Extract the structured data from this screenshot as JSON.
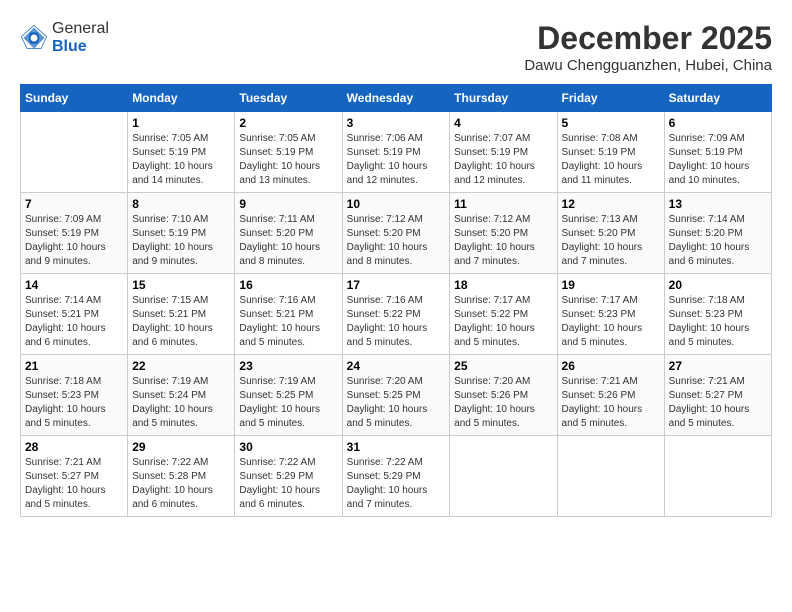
{
  "header": {
    "logo_line1": "General",
    "logo_line2": "Blue",
    "month_title": "December 2025",
    "location": "Dawu Chengguanzhen, Hubei, China"
  },
  "calendar": {
    "weekdays": [
      "Sunday",
      "Monday",
      "Tuesday",
      "Wednesday",
      "Thursday",
      "Friday",
      "Saturday"
    ],
    "weeks": [
      [
        {
          "day": "",
          "sunrise": "",
          "sunset": "",
          "daylight": ""
        },
        {
          "day": "1",
          "sunrise": "Sunrise: 7:05 AM",
          "sunset": "Sunset: 5:19 PM",
          "daylight": "Daylight: 10 hours and 14 minutes."
        },
        {
          "day": "2",
          "sunrise": "Sunrise: 7:05 AM",
          "sunset": "Sunset: 5:19 PM",
          "daylight": "Daylight: 10 hours and 13 minutes."
        },
        {
          "day": "3",
          "sunrise": "Sunrise: 7:06 AM",
          "sunset": "Sunset: 5:19 PM",
          "daylight": "Daylight: 10 hours and 12 minutes."
        },
        {
          "day": "4",
          "sunrise": "Sunrise: 7:07 AM",
          "sunset": "Sunset: 5:19 PM",
          "daylight": "Daylight: 10 hours and 12 minutes."
        },
        {
          "day": "5",
          "sunrise": "Sunrise: 7:08 AM",
          "sunset": "Sunset: 5:19 PM",
          "daylight": "Daylight: 10 hours and 11 minutes."
        },
        {
          "day": "6",
          "sunrise": "Sunrise: 7:09 AM",
          "sunset": "Sunset: 5:19 PM",
          "daylight": "Daylight: 10 hours and 10 minutes."
        }
      ],
      [
        {
          "day": "7",
          "sunrise": "Sunrise: 7:09 AM",
          "sunset": "Sunset: 5:19 PM",
          "daylight": "Daylight: 10 hours and 9 minutes."
        },
        {
          "day": "8",
          "sunrise": "Sunrise: 7:10 AM",
          "sunset": "Sunset: 5:19 PM",
          "daylight": "Daylight: 10 hours and 9 minutes."
        },
        {
          "day": "9",
          "sunrise": "Sunrise: 7:11 AM",
          "sunset": "Sunset: 5:20 PM",
          "daylight": "Daylight: 10 hours and 8 minutes."
        },
        {
          "day": "10",
          "sunrise": "Sunrise: 7:12 AM",
          "sunset": "Sunset: 5:20 PM",
          "daylight": "Daylight: 10 hours and 8 minutes."
        },
        {
          "day": "11",
          "sunrise": "Sunrise: 7:12 AM",
          "sunset": "Sunset: 5:20 PM",
          "daylight": "Daylight: 10 hours and 7 minutes."
        },
        {
          "day": "12",
          "sunrise": "Sunrise: 7:13 AM",
          "sunset": "Sunset: 5:20 PM",
          "daylight": "Daylight: 10 hours and 7 minutes."
        },
        {
          "day": "13",
          "sunrise": "Sunrise: 7:14 AM",
          "sunset": "Sunset: 5:20 PM",
          "daylight": "Daylight: 10 hours and 6 minutes."
        }
      ],
      [
        {
          "day": "14",
          "sunrise": "Sunrise: 7:14 AM",
          "sunset": "Sunset: 5:21 PM",
          "daylight": "Daylight: 10 hours and 6 minutes."
        },
        {
          "day": "15",
          "sunrise": "Sunrise: 7:15 AM",
          "sunset": "Sunset: 5:21 PM",
          "daylight": "Daylight: 10 hours and 6 minutes."
        },
        {
          "day": "16",
          "sunrise": "Sunrise: 7:16 AM",
          "sunset": "Sunset: 5:21 PM",
          "daylight": "Daylight: 10 hours and 5 minutes."
        },
        {
          "day": "17",
          "sunrise": "Sunrise: 7:16 AM",
          "sunset": "Sunset: 5:22 PM",
          "daylight": "Daylight: 10 hours and 5 minutes."
        },
        {
          "day": "18",
          "sunrise": "Sunrise: 7:17 AM",
          "sunset": "Sunset: 5:22 PM",
          "daylight": "Daylight: 10 hours and 5 minutes."
        },
        {
          "day": "19",
          "sunrise": "Sunrise: 7:17 AM",
          "sunset": "Sunset: 5:23 PM",
          "daylight": "Daylight: 10 hours and 5 minutes."
        },
        {
          "day": "20",
          "sunrise": "Sunrise: 7:18 AM",
          "sunset": "Sunset: 5:23 PM",
          "daylight": "Daylight: 10 hours and 5 minutes."
        }
      ],
      [
        {
          "day": "21",
          "sunrise": "Sunrise: 7:18 AM",
          "sunset": "Sunset: 5:23 PM",
          "daylight": "Daylight: 10 hours and 5 minutes."
        },
        {
          "day": "22",
          "sunrise": "Sunrise: 7:19 AM",
          "sunset": "Sunset: 5:24 PM",
          "daylight": "Daylight: 10 hours and 5 minutes."
        },
        {
          "day": "23",
          "sunrise": "Sunrise: 7:19 AM",
          "sunset": "Sunset: 5:25 PM",
          "daylight": "Daylight: 10 hours and 5 minutes."
        },
        {
          "day": "24",
          "sunrise": "Sunrise: 7:20 AM",
          "sunset": "Sunset: 5:25 PM",
          "daylight": "Daylight: 10 hours and 5 minutes."
        },
        {
          "day": "25",
          "sunrise": "Sunrise: 7:20 AM",
          "sunset": "Sunset: 5:26 PM",
          "daylight": "Daylight: 10 hours and 5 minutes."
        },
        {
          "day": "26",
          "sunrise": "Sunrise: 7:21 AM",
          "sunset": "Sunset: 5:26 PM",
          "daylight": "Daylight: 10 hours and 5 minutes."
        },
        {
          "day": "27",
          "sunrise": "Sunrise: 7:21 AM",
          "sunset": "Sunset: 5:27 PM",
          "daylight": "Daylight: 10 hours and 5 minutes."
        }
      ],
      [
        {
          "day": "28",
          "sunrise": "Sunrise: 7:21 AM",
          "sunset": "Sunset: 5:27 PM",
          "daylight": "Daylight: 10 hours and 5 minutes."
        },
        {
          "day": "29",
          "sunrise": "Sunrise: 7:22 AM",
          "sunset": "Sunset: 5:28 PM",
          "daylight": "Daylight: 10 hours and 6 minutes."
        },
        {
          "day": "30",
          "sunrise": "Sunrise: 7:22 AM",
          "sunset": "Sunset: 5:29 PM",
          "daylight": "Daylight: 10 hours and 6 minutes."
        },
        {
          "day": "31",
          "sunrise": "Sunrise: 7:22 AM",
          "sunset": "Sunset: 5:29 PM",
          "daylight": "Daylight: 10 hours and 7 minutes."
        },
        {
          "day": "",
          "sunrise": "",
          "sunset": "",
          "daylight": ""
        },
        {
          "day": "",
          "sunrise": "",
          "sunset": "",
          "daylight": ""
        },
        {
          "day": "",
          "sunrise": "",
          "sunset": "",
          "daylight": ""
        }
      ]
    ]
  }
}
